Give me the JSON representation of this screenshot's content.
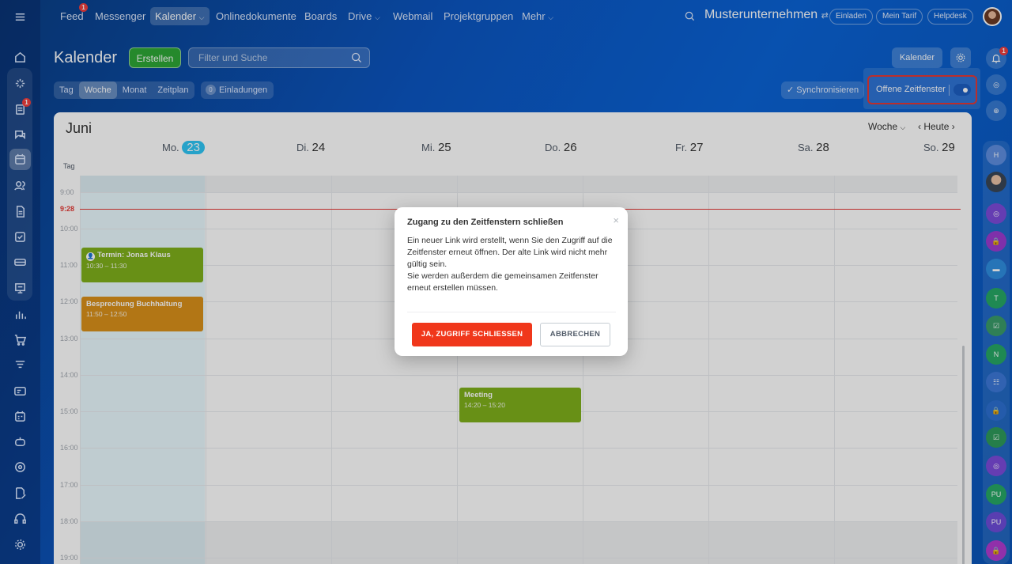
{
  "topnav": {
    "items": [
      "Feed",
      "Messenger",
      "Kalender",
      "Onlinedokumente",
      "Boards",
      "Drive",
      "Webmail",
      "Projektgruppen",
      "Mehr"
    ],
    "feed_badge": "1",
    "company": "Musterunternehmen",
    "invite": "Einladen",
    "tariff": "Mein Tarif",
    "helpdesk": "Helpdesk"
  },
  "sidebar": {
    "tasks_badge": "1"
  },
  "right_rail": {
    "notif_badge": "1",
    "items": [
      "H",
      "T",
      "N",
      "PU",
      "PU"
    ]
  },
  "header": {
    "title": "Kalender",
    "create": "Erstellen",
    "search_placeholder": "Filter und Suche",
    "calendar_btn": "Kalender",
    "view_tabs": [
      "Tag",
      "Woche",
      "Monat",
      "Zeitplan"
    ],
    "invitations_count": "0",
    "invitations": "Einladungen",
    "sync": "Synchronisieren",
    "open_slots": "Offene Zeitfenster"
  },
  "calendar": {
    "month": "Juni",
    "view": "Woche",
    "today_btn": "Heute",
    "allday_label": "Tag",
    "days": [
      {
        "name": "Mo.",
        "num": "23"
      },
      {
        "name": "Di.",
        "num": "24"
      },
      {
        "name": "Mi.",
        "num": "25"
      },
      {
        "name": "Do.",
        "num": "26"
      },
      {
        "name": "Fr.",
        "num": "27"
      },
      {
        "name": "Sa.",
        "num": "28"
      },
      {
        "name": "So.",
        "num": "29"
      }
    ],
    "hours": [
      "9:00",
      "10:00",
      "11:00",
      "12:00",
      "13:00",
      "14:00",
      "15:00",
      "16:00",
      "17:00",
      "18:00",
      "19:00"
    ],
    "now": "9:28",
    "events": [
      {
        "title": "Termin: Jonas Klaus",
        "time": "10:30 – 11:30",
        "color": "#7fb01c"
      },
      {
        "title": "Besprechung Buchhaltung",
        "time": "11:50 – 12:50",
        "color": "#d9911a"
      },
      {
        "title": "Meeting",
        "time": "14:20 – 15:20",
        "color": "#7fb01c"
      }
    ]
  },
  "modal": {
    "title": "Zugang zu den Zeitfenstern schließen",
    "close": "×",
    "body_1": "Ein neuer Link wird erstellt, wenn Sie den Zugriff auf die Zeitfenster erneut öffnen. Der alte Link wird nicht mehr gültig sein.",
    "body_2": "Sie werden außerdem die gemeinsamen Zeitfenster erneut erstellen müssen.",
    "confirm": "JA, ZUGRIFF SCHLIESSEN",
    "cancel": "ABBRECHEN"
  },
  "colors": {
    "accent_green": "#2ea836",
    "today_blue": "#2fc6f6",
    "now_red": "#e53935",
    "confirm_red": "#f0371b"
  }
}
